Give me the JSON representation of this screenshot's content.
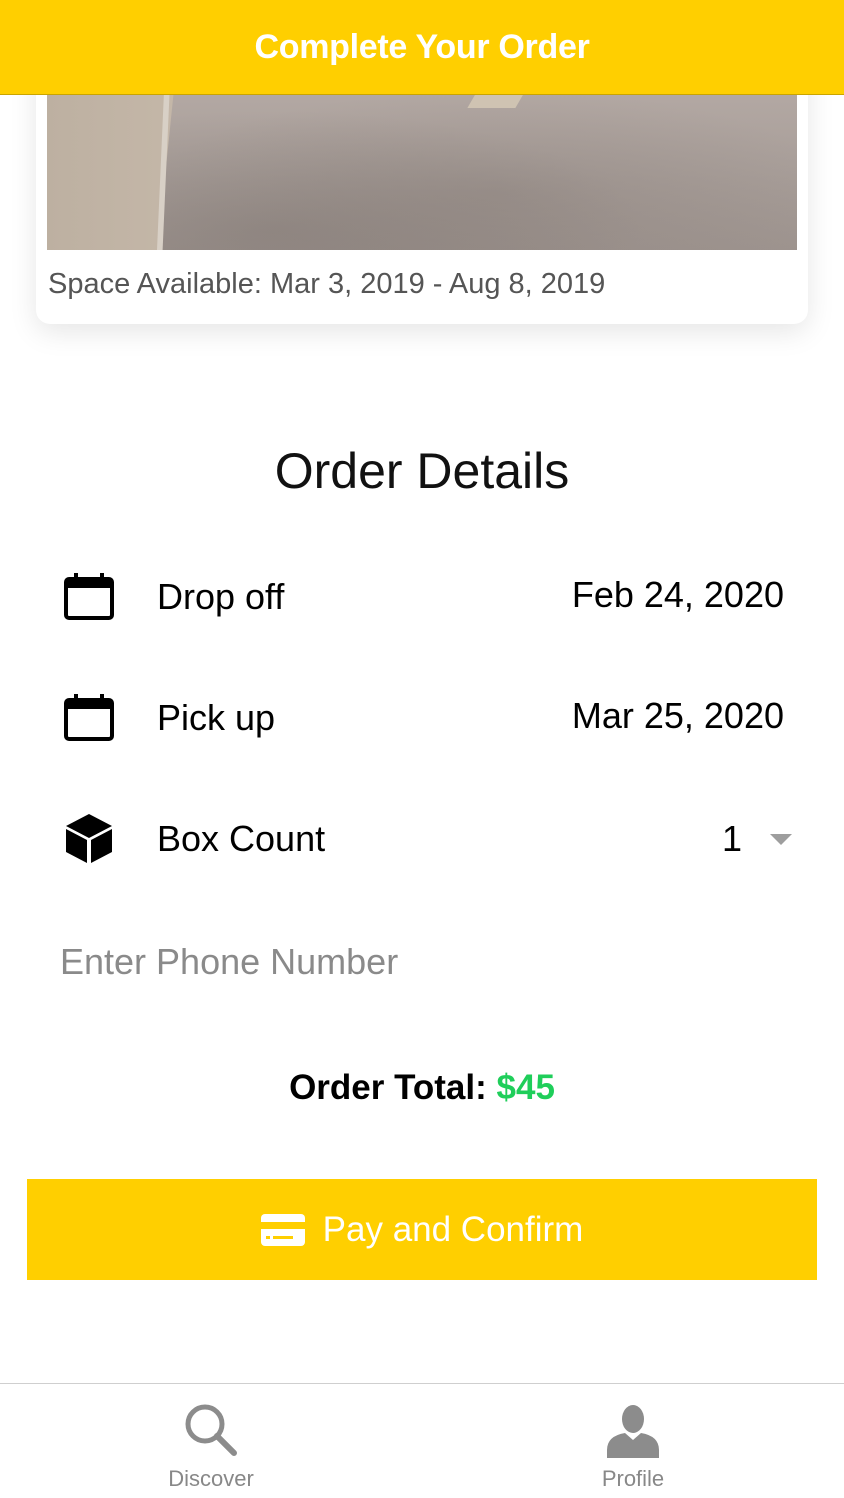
{
  "header": {
    "title": "Complete Your Order"
  },
  "space": {
    "availability": "Space Available: Mar 3, 2019 - Aug 8, 2019"
  },
  "order": {
    "section_title": "Order Details",
    "rows": [
      {
        "icon": "calendar-icon",
        "label": "Drop off",
        "value": "Feb 24, 2020"
      },
      {
        "icon": "calendar-icon",
        "label": "Pick up",
        "value": "Mar 25, 2020"
      },
      {
        "icon": "box-icon",
        "label": "Box Count",
        "value": "1"
      }
    ],
    "phone": {
      "placeholder": "Enter Phone Number",
      "value": ""
    },
    "total_label": "Order Total:",
    "total_amount": "$45",
    "pay_button_label": "Pay and Confirm",
    "pay_icon": "credit-card-icon"
  },
  "tabbar": {
    "items": [
      {
        "label": "Discover",
        "icon": "search-icon"
      },
      {
        "label": "Profile",
        "icon": "person-icon"
      }
    ]
  },
  "colors": {
    "accent": "#ffcf00",
    "total_green": "#1fce5a",
    "tab_gray": "#888888"
  }
}
